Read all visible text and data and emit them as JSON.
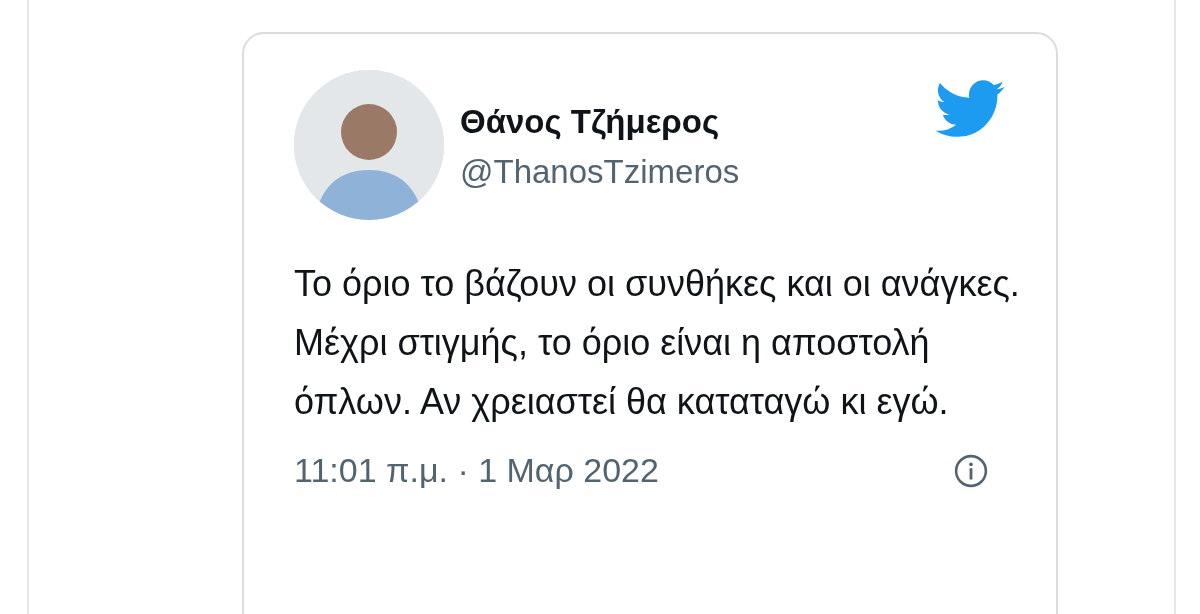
{
  "tweet": {
    "author_name": "Θάνος Τζήμερος",
    "handle": "@ThanosTzimeros",
    "text": "Το όριο το βάζουν οι συνθήκες και οι ανάγκες. Μέχρι στιγμής, το όριο είναι η αποστολή όπλων. Αν χρειαστεί θα καταταγώ κι εγώ.",
    "timestamp": "11:01 π.μ. · 1 Μαρ 2022"
  }
}
